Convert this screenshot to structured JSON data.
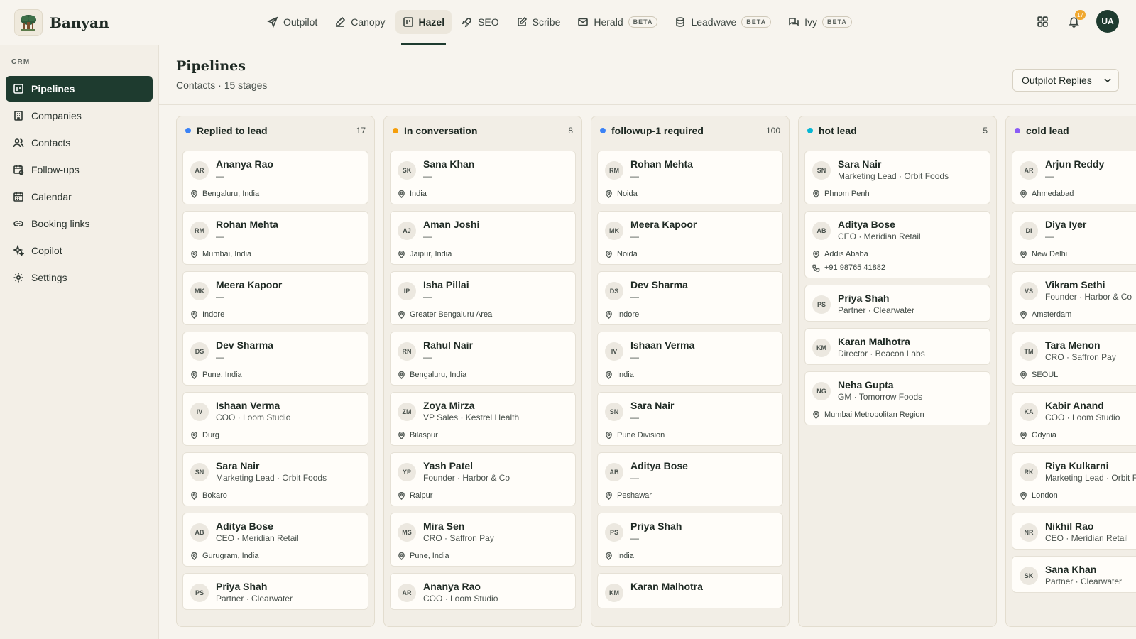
{
  "app": {
    "name": "Banyan"
  },
  "nav": [
    {
      "label": "Outpilot",
      "icon": "send-icon",
      "beta": false,
      "active": false
    },
    {
      "label": "Canopy",
      "icon": "edit-icon",
      "beta": false,
      "active": false
    },
    {
      "label": "Hazel",
      "icon": "board-icon",
      "beta": false,
      "active": true
    },
    {
      "label": "SEO",
      "icon": "rocket-icon",
      "beta": false,
      "active": false
    },
    {
      "label": "Scribe",
      "icon": "pen-square-icon",
      "beta": false,
      "active": false
    },
    {
      "label": "Herald",
      "icon": "mail-icon",
      "beta": true,
      "active": false
    },
    {
      "label": "Leadwave",
      "icon": "database-icon",
      "beta": true,
      "active": false
    },
    {
      "label": "Ivy",
      "icon": "chat-icon",
      "beta": true,
      "active": false
    }
  ],
  "beta_label": "BETA",
  "topbar": {
    "notifications_count": "17",
    "user_initials": "UA"
  },
  "sidebar": {
    "section": "CRM",
    "items": [
      {
        "label": "Pipelines",
        "icon": "board-icon",
        "active": true
      },
      {
        "label": "Companies",
        "icon": "building-icon",
        "active": false
      },
      {
        "label": "Contacts",
        "icon": "users-icon",
        "active": false
      },
      {
        "label": "Follow-ups",
        "icon": "calendar-clock-icon",
        "active": false
      },
      {
        "label": "Calendar",
        "icon": "calendar-icon",
        "active": false
      },
      {
        "label": "Booking links",
        "icon": "link-icon",
        "active": false
      },
      {
        "label": "Copilot",
        "icon": "sparkles-icon",
        "active": false
      },
      {
        "label": "Settings",
        "icon": "gear-icon",
        "active": false
      }
    ]
  },
  "page": {
    "title": "Pipelines",
    "subtitle": "Contacts · 15 stages",
    "pipeline_select": "Outpilot Replies"
  },
  "columns": [
    {
      "title": "Replied to lead",
      "count": "17",
      "color": "#3b82f6",
      "cards": [
        {
          "initials": "AR",
          "name": "Ananya Rao",
          "subtitle": "—",
          "location": "Bengaluru, India"
        },
        {
          "initials": "RM",
          "name": "Rohan Mehta",
          "subtitle": "—",
          "location": "Mumbai, India"
        },
        {
          "initials": "MK",
          "name": "Meera Kapoor",
          "subtitle": "—",
          "location": "Indore"
        },
        {
          "initials": "DS",
          "name": "Dev Sharma",
          "subtitle": "—",
          "location": "Pune, India"
        },
        {
          "initials": "IV",
          "name": "Ishaan Verma",
          "subtitle": "COO · Loom Studio",
          "location": "Durg"
        },
        {
          "initials": "SN",
          "name": "Sara Nair",
          "subtitle": "Marketing Lead · Orbit Foods",
          "location": "Bokaro"
        },
        {
          "initials": "AB",
          "name": "Aditya Bose",
          "subtitle": "CEO · Meridian Retail",
          "location": "Gurugram, India"
        },
        {
          "initials": "PS",
          "name": "Priya Shah",
          "subtitle": "Partner · Clearwater",
          "location": ""
        }
      ]
    },
    {
      "title": "In conversation",
      "count": "8",
      "color": "#f59e0b",
      "cards": [
        {
          "initials": "SK",
          "name": "Sana Khan",
          "subtitle": "—",
          "location": "India"
        },
        {
          "initials": "AJ",
          "name": "Aman Joshi",
          "subtitle": "—",
          "location": "Jaipur, India"
        },
        {
          "initials": "IP",
          "name": "Isha Pillai",
          "subtitle": "—",
          "location": "Greater Bengaluru Area"
        },
        {
          "initials": "RN",
          "name": "Rahul Nair",
          "subtitle": "—",
          "location": "Bengaluru, India"
        },
        {
          "initials": "ZM",
          "name": "Zoya Mirza",
          "subtitle": "VP Sales · Kestrel Health",
          "location": "Bilaspur"
        },
        {
          "initials": "YP",
          "name": "Yash Patel",
          "subtitle": "Founder · Harbor & Co",
          "location": "Raipur"
        },
        {
          "initials": "MS",
          "name": "Mira Sen",
          "subtitle": "CRO · Saffron Pay",
          "location": "Pune, India"
        },
        {
          "initials": "AR",
          "name": "Ananya Rao",
          "subtitle": "COO · Loom Studio",
          "location": ""
        }
      ]
    },
    {
      "title": "followup-1 required",
      "count": "100",
      "color": "#3b82f6",
      "cards": [
        {
          "initials": "RM",
          "name": "Rohan Mehta",
          "subtitle": "—",
          "location": "Noida"
        },
        {
          "initials": "MK",
          "name": "Meera Kapoor",
          "subtitle": "—",
          "location": "Noida"
        },
        {
          "initials": "DS",
          "name": "Dev Sharma",
          "subtitle": "—",
          "location": "Indore"
        },
        {
          "initials": "IV",
          "name": "Ishaan Verma",
          "subtitle": "—",
          "location": "India"
        },
        {
          "initials": "SN",
          "name": "Sara Nair",
          "subtitle": "—",
          "location": "Pune Division"
        },
        {
          "initials": "AB",
          "name": "Aditya Bose",
          "subtitle": "—",
          "location": "Peshawar"
        },
        {
          "initials": "PS",
          "name": "Priya Shah",
          "subtitle": "—",
          "location": "India"
        },
        {
          "initials": "KM",
          "name": "Karan Malhotra",
          "subtitle": "",
          "location": ""
        }
      ]
    },
    {
      "title": "hot lead",
      "count": "5",
      "color": "#06b6d4",
      "cards": [
        {
          "initials": "SN",
          "name": "Sara Nair",
          "subtitle": "Marketing Lead · Orbit Foods",
          "location": "Phnom Penh"
        },
        {
          "initials": "AB",
          "name": "Aditya Bose",
          "subtitle": "CEO · Meridian Retail",
          "location": "Addis Ababa",
          "phone": "+91 98765 41882"
        },
        {
          "initials": "PS",
          "name": "Priya Shah",
          "subtitle": "Partner · Clearwater",
          "location": ""
        },
        {
          "initials": "KM",
          "name": "Karan Malhotra",
          "subtitle": "Director · Beacon Labs",
          "location": ""
        },
        {
          "initials": "NG",
          "name": "Neha Gupta",
          "subtitle": "GM · Tomorrow Foods",
          "location": "Mumbai Metropolitan Region"
        }
      ]
    },
    {
      "title": "cold lead",
      "count": "",
      "color": "#8b5cf6",
      "cards": [
        {
          "initials": "AR",
          "name": "Arjun Reddy",
          "subtitle": "—",
          "location": "Ahmedabad"
        },
        {
          "initials": "DI",
          "name": "Diya Iyer",
          "subtitle": "—",
          "location": "New Delhi"
        },
        {
          "initials": "VS",
          "name": "Vikram Sethi",
          "subtitle": "Founder · Harbor & Co",
          "location": "Amsterdam"
        },
        {
          "initials": "TM",
          "name": "Tara Menon",
          "subtitle": "CRO · Saffron Pay",
          "location": "SEOUL"
        },
        {
          "initials": "KA",
          "name": "Kabir Anand",
          "subtitle": "COO · Loom Studio",
          "location": "Gdynia"
        },
        {
          "initials": "RK",
          "name": "Riya Kulkarni",
          "subtitle": "Marketing Lead · Orbit Foods",
          "location": "London"
        },
        {
          "initials": "NR",
          "name": "Nikhil Rao",
          "subtitle": "CEO · Meridian Retail",
          "location": ""
        },
        {
          "initials": "SK",
          "name": "Sana Khan",
          "subtitle": "Partner · Clearwater",
          "location": ""
        }
      ]
    }
  ]
}
